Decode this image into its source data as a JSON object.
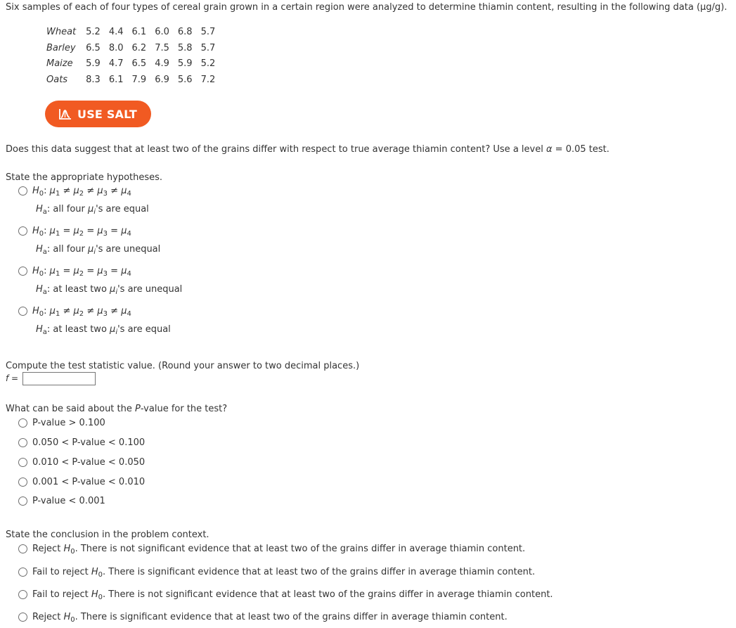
{
  "intro": "Six samples of each of four types of cereal grain grown in a certain region were analyzed to determine thiamin content, resulting in the following data (μg/g).",
  "table": {
    "rows": [
      {
        "label": "Wheat",
        "values": [
          "5.2",
          "4.4",
          "6.1",
          "6.0",
          "6.8",
          "5.7"
        ]
      },
      {
        "label": "Barley",
        "values": [
          "6.5",
          "8.0",
          "6.2",
          "7.5",
          "5.8",
          "5.7"
        ]
      },
      {
        "label": "Maize",
        "values": [
          "5.9",
          "4.7",
          "6.5",
          "4.9",
          "5.9",
          "5.2"
        ]
      },
      {
        "label": "Oats",
        "values": [
          "8.3",
          "6.1",
          "7.9",
          "6.9",
          "5.6",
          "7.2"
        ]
      }
    ]
  },
  "salt_button": {
    "label": "USE SALT",
    "icon": "salt-chart-icon",
    "color": "#f15a22"
  },
  "question_main": {
    "pre": "Does this data suggest that at least two of the grains differ with respect to true average thiamin content? Use a level ",
    "alpha": "α",
    "post": " = 0.05 test."
  },
  "hypotheses": {
    "prompt": "State the appropriate hypotheses.",
    "options": [
      {
        "h0_rel": "≠",
        "ha_text_pre": ": all four ",
        "ha_text_post": "'s are equal"
      },
      {
        "h0_rel": "=",
        "ha_text_pre": ": all four ",
        "ha_text_post": "'s are unequal"
      },
      {
        "h0_rel": "=",
        "ha_text_pre": ": at least two ",
        "ha_text_post": "'s are unequal"
      },
      {
        "h0_rel": "≠",
        "ha_text_pre": ": at least two ",
        "ha_text_post": "'s are equal"
      }
    ]
  },
  "statistic": {
    "prompt": "Compute the test statistic value. (Round your answer to two decimal places.)",
    "label": "f =",
    "value": ""
  },
  "pvalue": {
    "prompt_pre": "What can be said about the ",
    "prompt_p": "P",
    "prompt_post": "-value for the test?",
    "options": [
      "P-value > 0.100",
      "0.050 < P-value < 0.100",
      "0.010 < P-value < 0.050",
      "0.001 < P-value < 0.010",
      "P-value < 0.001"
    ]
  },
  "conclusion": {
    "prompt": "State the conclusion in the problem context.",
    "options": [
      {
        "pre": "Reject ",
        "post": ". There is not significant evidence that at least two of the grains differ in average thiamin content."
      },
      {
        "pre": "Fail to reject ",
        "post": ". There is significant evidence that at least two of the grains differ in average thiamin content."
      },
      {
        "pre": "Fail to reject ",
        "post": ". There is not significant evidence that at least two of the grains differ in average thiamin content."
      },
      {
        "pre": "Reject ",
        "post": ". There is significant evidence that at least two of the grains differ in average thiamin content."
      }
    ]
  }
}
